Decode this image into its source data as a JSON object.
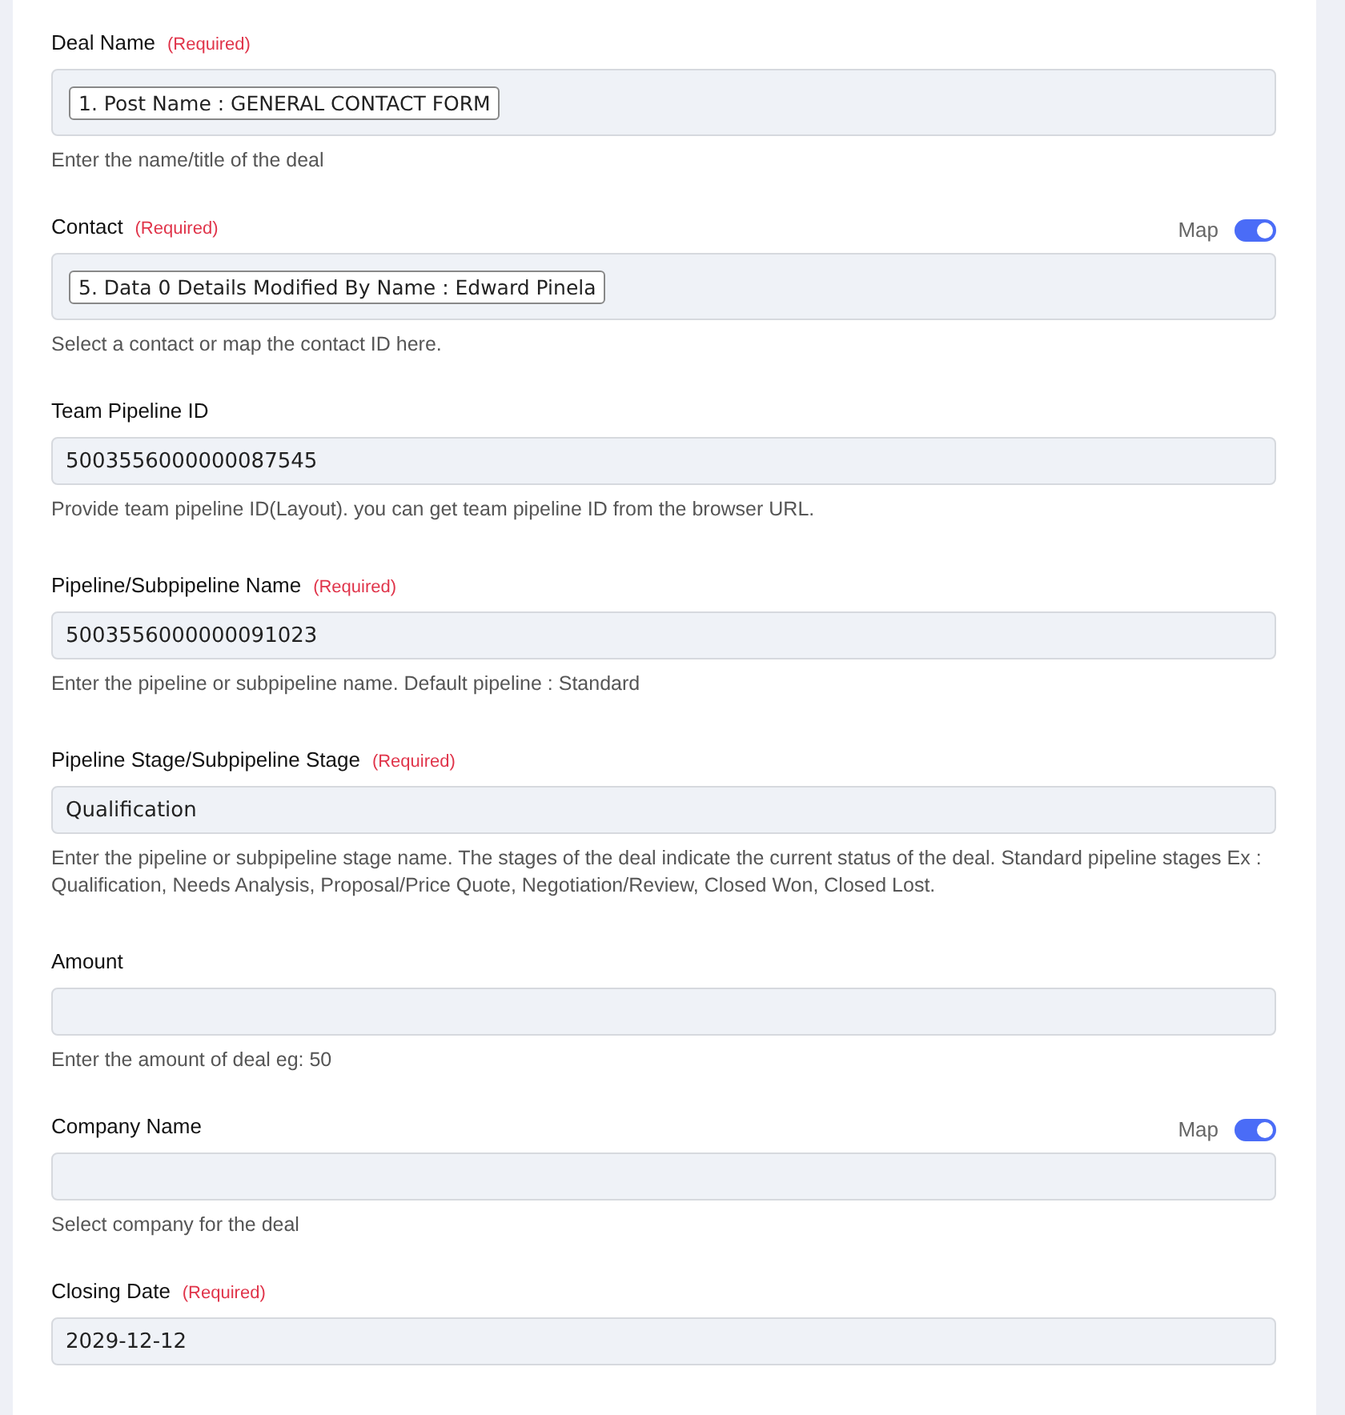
{
  "fields": [
    {
      "label": "Deal Name",
      "required_note": "(Required)",
      "kind": "tag",
      "value": "1. Post Name : GENERAL CONTACT FORM",
      "hint": "Enter the name/title of the deal"
    },
    {
      "label": "Contact",
      "required_note": "(Required)",
      "map": {
        "label": "Map",
        "on": true
      },
      "kind": "tag",
      "value": "5. Data 0 Details Modified By Name : Edward Pinela",
      "hint": "Select a contact or map the contact ID here."
    },
    {
      "label": "Team Pipeline ID",
      "kind": "text",
      "value": "5003556000000087545",
      "hint": "Provide team pipeline ID(Layout). you can get team pipeline ID from the browser URL."
    },
    {
      "label": "Pipeline/Subpipeline Name",
      "required_note": "(Required)",
      "kind": "text",
      "value": "5003556000000091023",
      "hint": "Enter the pipeline or subpipeline name. Default pipeline : Standard"
    },
    {
      "label": "Pipeline Stage/Subpipeline Stage",
      "required_note": "(Required)",
      "kind": "text",
      "value": "Qualification",
      "hint": "Enter the pipeline or subpipeline stage name. The stages of the deal indicate the current status of the deal. Standard pipeline stages Ex : Qualification, Needs Analysis, Proposal/Price Quote, Negotiation/Review, Closed Won, Closed Lost."
    },
    {
      "label": "Amount",
      "kind": "text",
      "hint": "Enter the amount of deal eg: 50"
    },
    {
      "label": "Company Name",
      "map": {
        "label": "Map",
        "on": true
      },
      "kind": "text",
      "hint": "Select company for the deal"
    },
    {
      "label": "Closing Date",
      "required_note": "(Required)",
      "kind": "text",
      "value": "2029-12-12"
    }
  ]
}
